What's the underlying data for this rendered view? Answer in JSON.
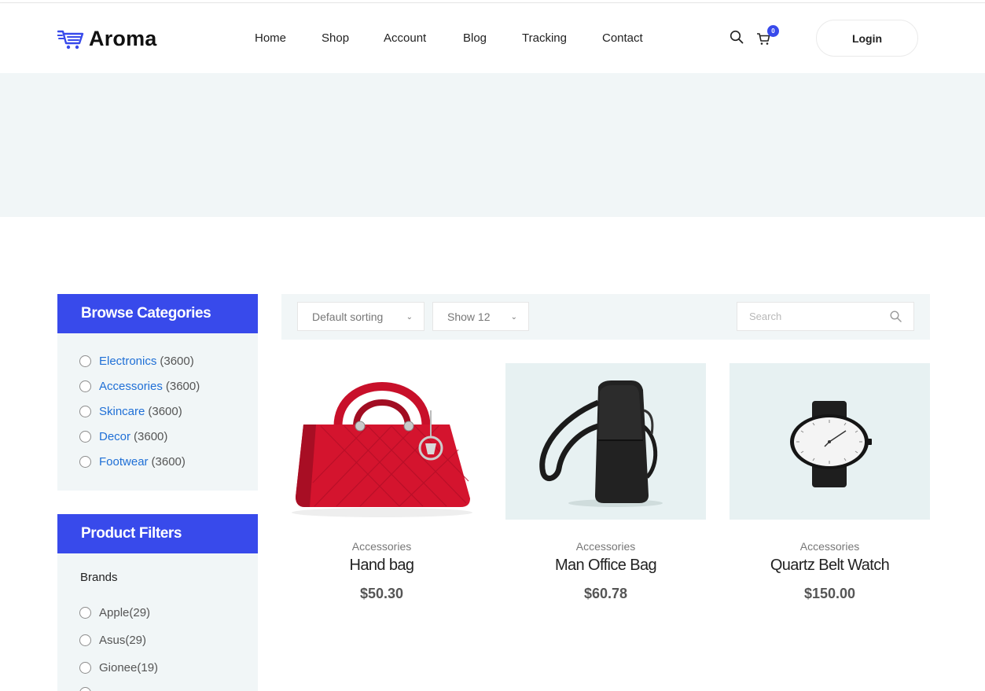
{
  "brand": {
    "name": "Aroma",
    "accent": "#384aeb"
  },
  "nav": {
    "items": [
      "Home",
      "Shop",
      "Account",
      "Blog",
      "Tracking",
      "Contact"
    ],
    "cart_count": "0",
    "login_label": "Login"
  },
  "sidebar": {
    "categories": {
      "title": "Browse Categories",
      "items": [
        {
          "name": "Electronics",
          "count": "(3600)"
        },
        {
          "name": "Accessories",
          "count": "(3600)"
        },
        {
          "name": "Skincare",
          "count": "(3600)"
        },
        {
          "name": "Decor",
          "count": "(3600)"
        },
        {
          "name": "Footwear",
          "count": "(3600)"
        }
      ]
    },
    "filters": {
      "title": "Product Filters",
      "brands_label": "Brands",
      "brands": [
        "Apple(29)",
        "Asus(29)",
        "Gionee(19)"
      ]
    }
  },
  "toolbar": {
    "sorting": "Default sorting",
    "show": "Show 12",
    "search_placeholder": "Search"
  },
  "products": [
    {
      "category": "Accessories",
      "title": "Hand bag",
      "price": "$50.30"
    },
    {
      "category": "Accessories",
      "title": "Man Office Bag",
      "price": "$60.78"
    },
    {
      "category": "Accessories",
      "title": "Quartz Belt Watch",
      "price": "$150.00"
    }
  ]
}
